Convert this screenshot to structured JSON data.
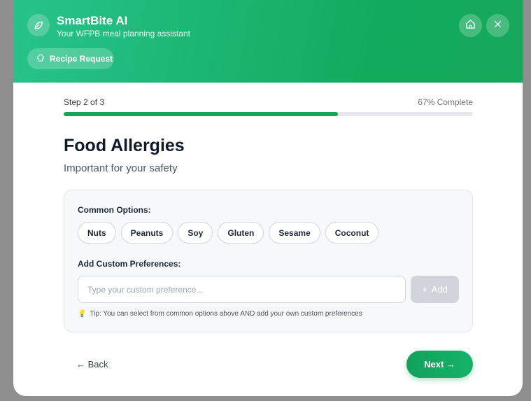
{
  "header": {
    "title": "SmartBite AI",
    "subtitle": "Your WFPB meal planning assistant",
    "badge_label": "Recipe Request"
  },
  "progress": {
    "step_label": "Step 2 of 3",
    "percent_label": "67% Complete",
    "fraction": 0.67
  },
  "page": {
    "title": "Food Allergies",
    "subtitle": "Important for your safety"
  },
  "options": {
    "common_label": "Common Options:",
    "chips": [
      "Nuts",
      "Peanuts",
      "Soy",
      "Gluten",
      "Sesame",
      "Coconut"
    ]
  },
  "custom": {
    "label": "Add Custom Preferences:",
    "placeholder": "Type your custom preference...",
    "value": "",
    "add_label": "Add"
  },
  "tip": {
    "text": "Tip: You can select from common options above AND add your own custom preferences"
  },
  "footer": {
    "back_label": "← Back",
    "next_label": "Next →"
  },
  "colors": {
    "accent": "#16a45b",
    "header_start": "#27c38b",
    "header_end": "#12ab5e"
  }
}
